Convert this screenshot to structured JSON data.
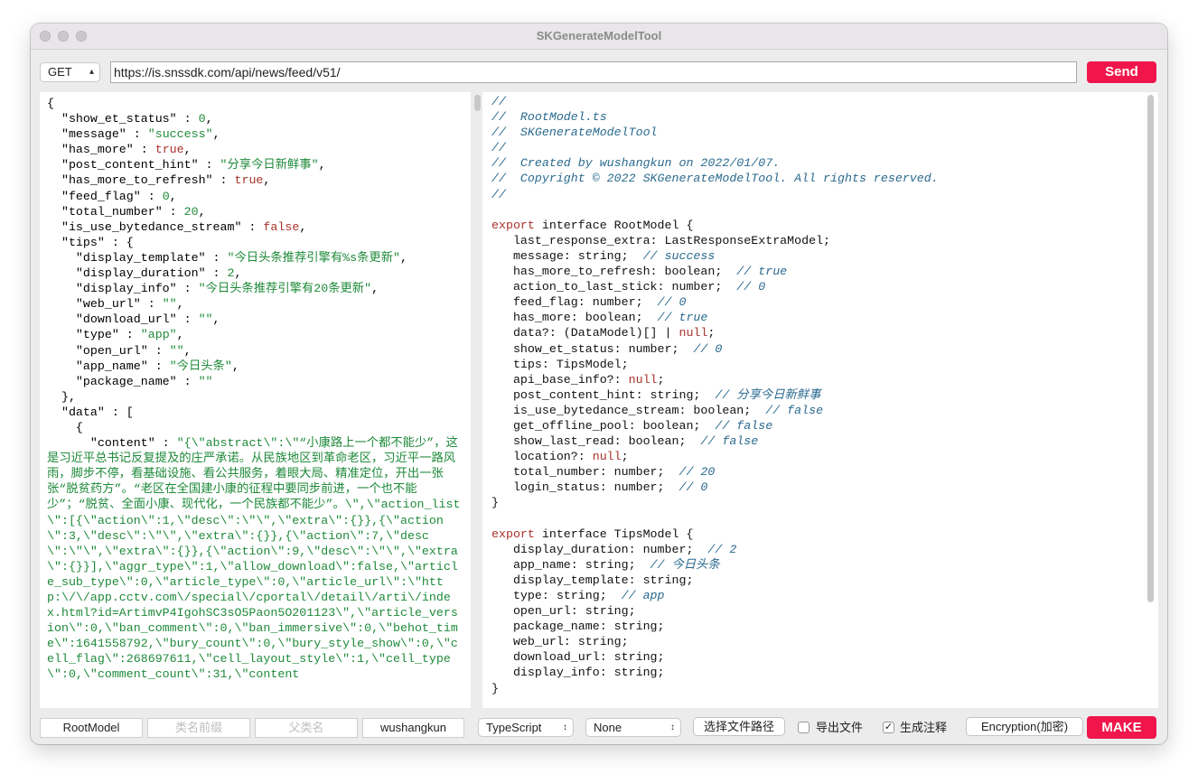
{
  "window": {
    "title": "SKGenerateModelTool"
  },
  "request": {
    "method": "GET",
    "url": "https://is.snssdk.com/api/news/feed/v51/",
    "send_label": "Send"
  },
  "left_lines": [
    "{",
    "  \"show_et_status\" : 0,",
    "  \"message\" : \"success\",",
    "  \"has_more\" : true,",
    "  \"post_content_hint\" : \"分享今日新鲜事\",",
    "  \"has_more_to_refresh\" : true,",
    "  \"feed_flag\" : 0,",
    "  \"total_number\" : 20,",
    "  \"is_use_bytedance_stream\" : false,",
    "  \"tips\" : {",
    "    \"display_template\" : \"今日头条推荐引擎有%s条更新\",",
    "    \"display_duration\" : 2,",
    "    \"display_info\" : \"今日头条推荐引擎有20条更新\",",
    "    \"web_url\" : \"\",",
    "    \"download_url\" : \"\",",
    "    \"type\" : \"app\",",
    "    \"open_url\" : \"\",",
    "    \"app_name\" : \"今日头条\",",
    "    \"package_name\" : \"\"",
    "  },",
    "  \"data\" : [",
    "    {",
    "      \"content\" : "
  ],
  "content_value": "\"{\\\"abstract\\\":\\\"“小康路上一个都不能少”，这是习近平总书记反复提及的庄严承诺。从民族地区到革命老区，习近平一路风雨，脚步不停，看基础设施、看公共服务，着眼大局、精准定位，开出一张张“脱贫药方”。“老区在全国建小康的征程中要同步前进，一个也不能少”；“脱贫、全面小康、现代化，一个民族都不能少”。\\\",\\\"action_list\\\":[{\\\"action\\\":1,\\\"desc\\\":\\\"\\\",\\\"extra\\\":{}},{\\\"action\\\":3,\\\"desc\\\":\\\"\\\",\\\"extra\\\":{}},{\\\"action\\\":7,\\\"desc\\\":\\\"\\\",\\\"extra\\\":{}},{\\\"action\\\":9,\\\"desc\\\":\\\"\\\",\\\"extra\\\":{}}],\\\"aggr_type\\\":1,\\\"allow_download\\\":false,\\\"article_sub_type\\\":0,\\\"article_type\\\":0,\\\"article_url\\\":\\\"http:\\/\\/app.cctv.com\\/special\\/cportal\\/detail\\/arti\\/index.html?id=ArtimvP4IgohSC3sO5Paon5O201123\\\",\\\"article_version\\\":0,\\\"ban_comment\\\":0,\\\"ban_immersive\\\":0,\\\"behot_time\\\":1641558792,\\\"bury_count\\\":0,\\\"bury_style_show\\\":0,\\\"cell_flag\\\":268697611,\\\"cell_layout_style\\\":1,\\\"cell_type\\\":0,\\\"comment_count\\\":31,\\\"content",
  "header_comments": [
    "//",
    "//  RootModel.ts",
    "//  SKGenerateModelTool",
    "//",
    "//  Created by wushangkun on 2022/01/07.",
    "//  Copyright © 2022 SKGenerateModelTool. All rights reserved.",
    "//"
  ],
  "interfaces": [
    {
      "keyword": "export",
      "decl": " interface RootModel {",
      "fields": [
        {
          "t": "last_response_extra: LastResponseExtraModel;",
          "n": "",
          "c": ""
        },
        {
          "t": "message: string;",
          "n": "",
          "c": "  // success"
        },
        {
          "t": "has_more_to_refresh: boolean;",
          "n": "",
          "c": "  // true"
        },
        {
          "t": "action_to_last_stick: number;",
          "n": "",
          "c": "  // 0"
        },
        {
          "t": "feed_flag: number;",
          "n": "",
          "c": "  // 0"
        },
        {
          "t": "has_more: boolean;",
          "n": "",
          "c": "  // true"
        },
        {
          "t": "data?: (DataModel)[] | ",
          "n": "null",
          "c": ";"
        },
        {
          "t": "show_et_status: number;",
          "n": "",
          "c": "  // 0"
        },
        {
          "t": "tips: TipsModel;",
          "n": "",
          "c": ""
        },
        {
          "t": "api_base_info?: ",
          "n": "null",
          "c": ";"
        },
        {
          "t": "post_content_hint: string;",
          "n": "",
          "c": "  // 分享今日新鲜事"
        },
        {
          "t": "is_use_bytedance_stream: boolean;",
          "n": "",
          "c": "  // false"
        },
        {
          "t": "get_offline_pool: boolean;",
          "n": "",
          "c": "  // false"
        },
        {
          "t": "show_last_read: boolean;",
          "n": "",
          "c": "  // false"
        },
        {
          "t": "location?: ",
          "n": "null",
          "c": ";"
        },
        {
          "t": "total_number: number;",
          "n": "",
          "c": "  // 20"
        },
        {
          "t": "login_status: number;",
          "n": "",
          "c": "  // 0"
        }
      ],
      "close": "}"
    },
    {
      "keyword": "export",
      "decl": " interface TipsModel {",
      "fields": [
        {
          "t": "display_duration: number;",
          "n": "",
          "c": "  // 2"
        },
        {
          "t": "app_name: string;",
          "n": "",
          "c": "  // 今日头条"
        },
        {
          "t": "display_template: string;",
          "n": "",
          "c": ""
        },
        {
          "t": "type: string;",
          "n": "",
          "c": "  // app"
        },
        {
          "t": "open_url: string;",
          "n": "",
          "c": ""
        },
        {
          "t": "package_name: string;",
          "n": "",
          "c": ""
        },
        {
          "t": "web_url: string;",
          "n": "",
          "c": ""
        },
        {
          "t": "download_url: string;",
          "n": "",
          "c": ""
        },
        {
          "t": "display_info: string;",
          "n": "",
          "c": ""
        }
      ],
      "close": "}"
    }
  ],
  "bottom": {
    "root_model_value": "RootModel",
    "class_prefix_placeholder": "类名前缀",
    "parent_class_placeholder": "父类名",
    "author_value": "wushangkun",
    "language": "TypeScript",
    "option": "None",
    "choose_path_label": "选择文件路径",
    "export_file_label": "导出文件",
    "export_file_checked": false,
    "gen_comment_label": "生成注释",
    "gen_comment_checked": true,
    "encryption_label": "Encryption(加密)",
    "make_label": "MAKE"
  },
  "colors": {
    "accent_red": "#f0164b",
    "string_green": "#1f8a3a",
    "comment_teal": "#2a6a8e",
    "keyword_red": "#a8322a"
  },
  "icons": {
    "select_arrows": "up-down-chevron-icon",
    "checkmark": "check-icon"
  }
}
